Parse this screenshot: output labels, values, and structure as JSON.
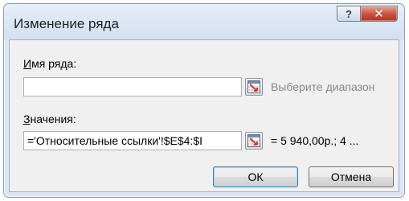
{
  "dialog": {
    "title": "Изменение ряда",
    "help_glyph": "?",
    "close_glyph": "✕"
  },
  "series_name": {
    "label_accel": "И",
    "label_rest": "мя ряда:",
    "value": "",
    "hint": "Выберите диапазон"
  },
  "series_values": {
    "label_accel": "З",
    "label_rest": "начения:",
    "value": "='Относительные ссылки'!$E$4:$I",
    "preview": "= 5 940,00р.; 4 ..."
  },
  "buttons": {
    "ok": "ОК",
    "cancel": "Отмена"
  },
  "colors": {
    "window_frame": "#dbe6f3",
    "client": "#f0f0f0",
    "close_red": "#c9503a",
    "hint_gray": "#8a8a8a",
    "default_button_border": "#3c7fb1"
  }
}
